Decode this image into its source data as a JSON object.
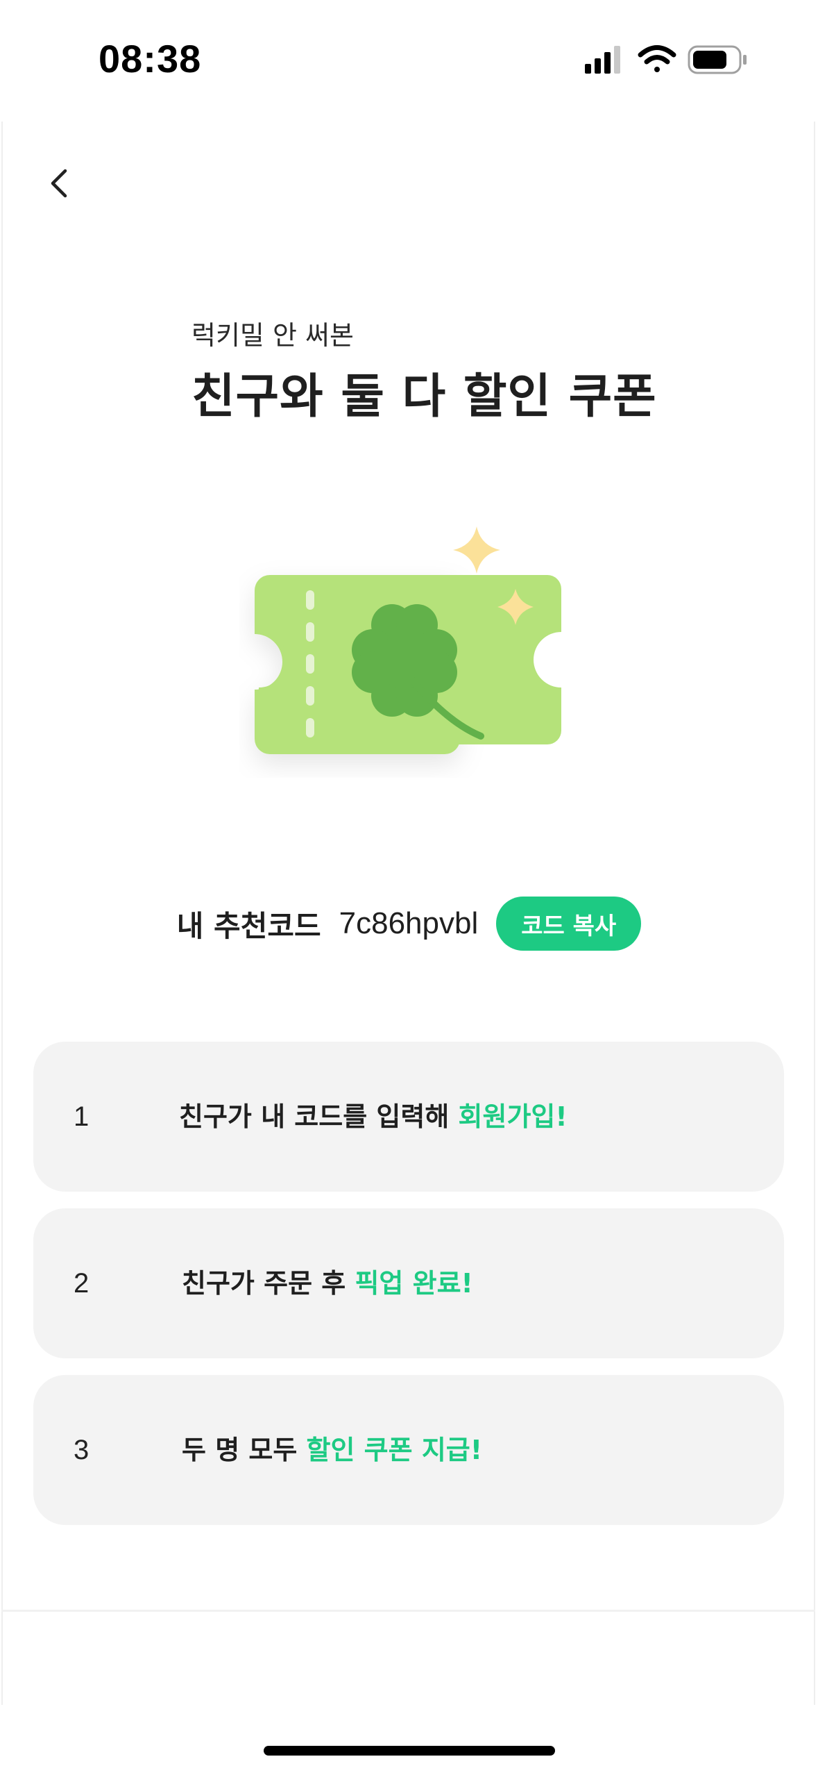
{
  "status_bar": {
    "time": "08:38",
    "icons": [
      "cellular-signal-icon",
      "wifi-icon",
      "battery-icon"
    ]
  },
  "header": {
    "back_icon": "chevron-left-icon"
  },
  "hero": {
    "subtitle": "럭키밀 안 써본",
    "title": "친구와 둘 다 할인 쿠폰",
    "illustration": "clover-ticket-illustration"
  },
  "referral": {
    "label": "내 추천코드",
    "code": "7c86hpvbl",
    "copy_button_label": "코드 복사"
  },
  "steps": [
    {
      "number": "1",
      "text": "친구가 내 코드를 입력해 ",
      "highlight": "회원가입!"
    },
    {
      "number": "2",
      "text": "친구가 주문 후 ",
      "highlight": "픽업 완료!"
    },
    {
      "number": "3",
      "text": "두 명 모두 ",
      "highlight": "할인 쿠폰 지급!"
    }
  ],
  "colors": {
    "accent": "#1dca83",
    "card_background": "#f3f3f3",
    "ticket_light_green": "#b5e27a",
    "clover_green": "#62b14a",
    "sparkle_yellow": "#fbe199"
  }
}
